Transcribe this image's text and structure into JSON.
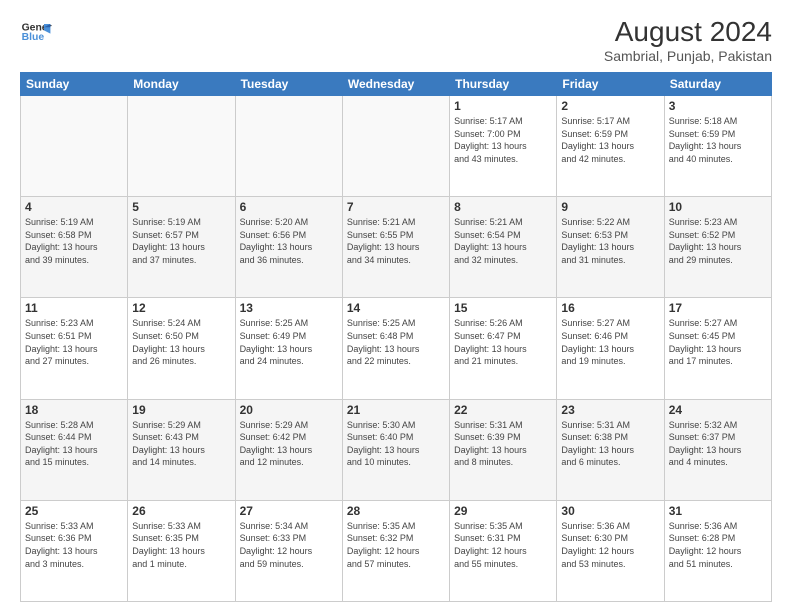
{
  "logo": {
    "line1": "General",
    "line2": "Blue"
  },
  "title": "August 2024",
  "subtitle": "Sambrial, Punjab, Pakistan",
  "weekdays": [
    "Sunday",
    "Monday",
    "Tuesday",
    "Wednesday",
    "Thursday",
    "Friday",
    "Saturday"
  ],
  "weeks": [
    [
      {
        "day": "",
        "info": ""
      },
      {
        "day": "",
        "info": ""
      },
      {
        "day": "",
        "info": ""
      },
      {
        "day": "",
        "info": ""
      },
      {
        "day": "1",
        "info": "Sunrise: 5:17 AM\nSunset: 7:00 PM\nDaylight: 13 hours\nand 43 minutes."
      },
      {
        "day": "2",
        "info": "Sunrise: 5:17 AM\nSunset: 6:59 PM\nDaylight: 13 hours\nand 42 minutes."
      },
      {
        "day": "3",
        "info": "Sunrise: 5:18 AM\nSunset: 6:59 PM\nDaylight: 13 hours\nand 40 minutes."
      }
    ],
    [
      {
        "day": "4",
        "info": "Sunrise: 5:19 AM\nSunset: 6:58 PM\nDaylight: 13 hours\nand 39 minutes."
      },
      {
        "day": "5",
        "info": "Sunrise: 5:19 AM\nSunset: 6:57 PM\nDaylight: 13 hours\nand 37 minutes."
      },
      {
        "day": "6",
        "info": "Sunrise: 5:20 AM\nSunset: 6:56 PM\nDaylight: 13 hours\nand 36 minutes."
      },
      {
        "day": "7",
        "info": "Sunrise: 5:21 AM\nSunset: 6:55 PM\nDaylight: 13 hours\nand 34 minutes."
      },
      {
        "day": "8",
        "info": "Sunrise: 5:21 AM\nSunset: 6:54 PM\nDaylight: 13 hours\nand 32 minutes."
      },
      {
        "day": "9",
        "info": "Sunrise: 5:22 AM\nSunset: 6:53 PM\nDaylight: 13 hours\nand 31 minutes."
      },
      {
        "day": "10",
        "info": "Sunrise: 5:23 AM\nSunset: 6:52 PM\nDaylight: 13 hours\nand 29 minutes."
      }
    ],
    [
      {
        "day": "11",
        "info": "Sunrise: 5:23 AM\nSunset: 6:51 PM\nDaylight: 13 hours\nand 27 minutes."
      },
      {
        "day": "12",
        "info": "Sunrise: 5:24 AM\nSunset: 6:50 PM\nDaylight: 13 hours\nand 26 minutes."
      },
      {
        "day": "13",
        "info": "Sunrise: 5:25 AM\nSunset: 6:49 PM\nDaylight: 13 hours\nand 24 minutes."
      },
      {
        "day": "14",
        "info": "Sunrise: 5:25 AM\nSunset: 6:48 PM\nDaylight: 13 hours\nand 22 minutes."
      },
      {
        "day": "15",
        "info": "Sunrise: 5:26 AM\nSunset: 6:47 PM\nDaylight: 13 hours\nand 21 minutes."
      },
      {
        "day": "16",
        "info": "Sunrise: 5:27 AM\nSunset: 6:46 PM\nDaylight: 13 hours\nand 19 minutes."
      },
      {
        "day": "17",
        "info": "Sunrise: 5:27 AM\nSunset: 6:45 PM\nDaylight: 13 hours\nand 17 minutes."
      }
    ],
    [
      {
        "day": "18",
        "info": "Sunrise: 5:28 AM\nSunset: 6:44 PM\nDaylight: 13 hours\nand 15 minutes."
      },
      {
        "day": "19",
        "info": "Sunrise: 5:29 AM\nSunset: 6:43 PM\nDaylight: 13 hours\nand 14 minutes."
      },
      {
        "day": "20",
        "info": "Sunrise: 5:29 AM\nSunset: 6:42 PM\nDaylight: 13 hours\nand 12 minutes."
      },
      {
        "day": "21",
        "info": "Sunrise: 5:30 AM\nSunset: 6:40 PM\nDaylight: 13 hours\nand 10 minutes."
      },
      {
        "day": "22",
        "info": "Sunrise: 5:31 AM\nSunset: 6:39 PM\nDaylight: 13 hours\nand 8 minutes."
      },
      {
        "day": "23",
        "info": "Sunrise: 5:31 AM\nSunset: 6:38 PM\nDaylight: 13 hours\nand 6 minutes."
      },
      {
        "day": "24",
        "info": "Sunrise: 5:32 AM\nSunset: 6:37 PM\nDaylight: 13 hours\nand 4 minutes."
      }
    ],
    [
      {
        "day": "25",
        "info": "Sunrise: 5:33 AM\nSunset: 6:36 PM\nDaylight: 13 hours\nand 3 minutes."
      },
      {
        "day": "26",
        "info": "Sunrise: 5:33 AM\nSunset: 6:35 PM\nDaylight: 13 hours\nand 1 minute."
      },
      {
        "day": "27",
        "info": "Sunrise: 5:34 AM\nSunset: 6:33 PM\nDaylight: 12 hours\nand 59 minutes."
      },
      {
        "day": "28",
        "info": "Sunrise: 5:35 AM\nSunset: 6:32 PM\nDaylight: 12 hours\nand 57 minutes."
      },
      {
        "day": "29",
        "info": "Sunrise: 5:35 AM\nSunset: 6:31 PM\nDaylight: 12 hours\nand 55 minutes."
      },
      {
        "day": "30",
        "info": "Sunrise: 5:36 AM\nSunset: 6:30 PM\nDaylight: 12 hours\nand 53 minutes."
      },
      {
        "day": "31",
        "info": "Sunrise: 5:36 AM\nSunset: 6:28 PM\nDaylight: 12 hours\nand 51 minutes."
      }
    ]
  ]
}
